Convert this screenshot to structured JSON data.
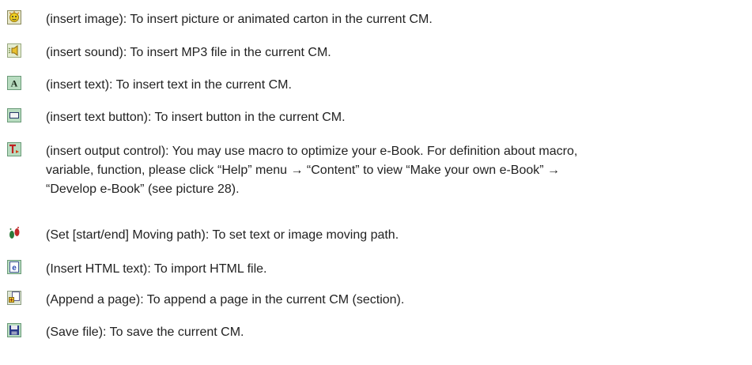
{
  "items": [
    {
      "icon": "insert-image-icon",
      "text": "(insert image): To insert picture or animated carton in the current CM."
    },
    {
      "icon": "insert-sound-icon",
      "text": "(insert sound): To insert MP3 file in the current CM."
    },
    {
      "icon": "insert-text-icon",
      "text": "(insert text): To insert text in the current CM."
    },
    {
      "icon": "insert-text-button-icon",
      "text": "(insert text button): To insert button in the current CM."
    },
    {
      "icon": "insert-output-control-icon",
      "lines": [
        "(insert output control): You may use macro to optimize your e-Book. For definition about macro,",
        "variable, function, please click “Help” menu →  “Content” to view “Make your own e-Book” →",
        "“Develop e-Book” (see picture 28)."
      ]
    },
    {
      "icon": "moving-path-icon",
      "text": "(Set [start/end] Moving path): To set text or image moving path."
    },
    {
      "icon": "insert-html-text-icon",
      "text": "(Insert HTML text): To import HTML file."
    },
    {
      "icon": "append-page-icon",
      "text": "(Append a page): To append a page in the current CM (section)."
    },
    {
      "icon": "save-file-icon",
      "text": "(Save file): To save the current CM."
    }
  ]
}
